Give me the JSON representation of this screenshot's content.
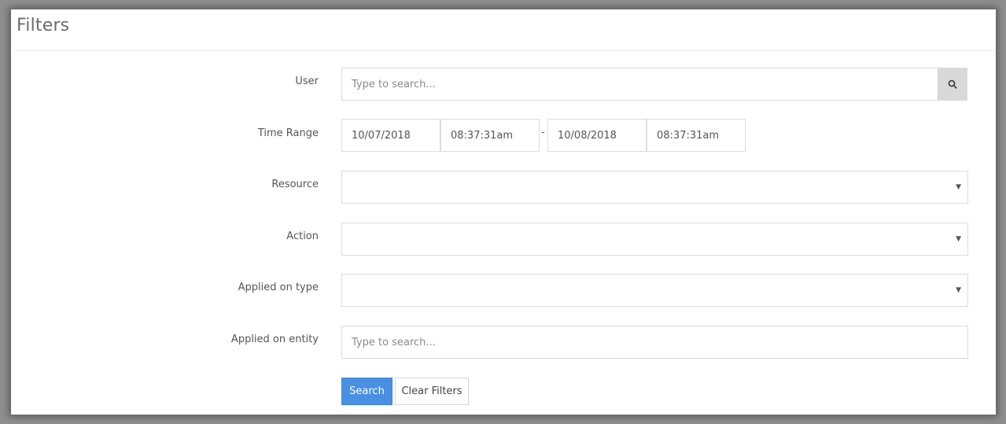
{
  "panel": {
    "title": "Filters"
  },
  "form": {
    "user": {
      "label": "User",
      "placeholder": "Type to search..."
    },
    "time_range": {
      "label": "Time Range",
      "start_date": "10/07/2018",
      "start_time": "08:37:31am",
      "separator": "-",
      "end_date": "10/08/2018",
      "end_time": "08:37:31am"
    },
    "resource": {
      "label": "Resource",
      "value": ""
    },
    "action": {
      "label": "Action",
      "value": ""
    },
    "applied_on_type": {
      "label": "Applied on type",
      "value": ""
    },
    "applied_on_entity": {
      "label": "Applied on entity",
      "placeholder": "Type to search..."
    }
  },
  "buttons": {
    "search": "Search",
    "clear": "Clear Filters"
  },
  "icons": {
    "search": "search-icon",
    "dropdown": "caret-down-icon"
  }
}
